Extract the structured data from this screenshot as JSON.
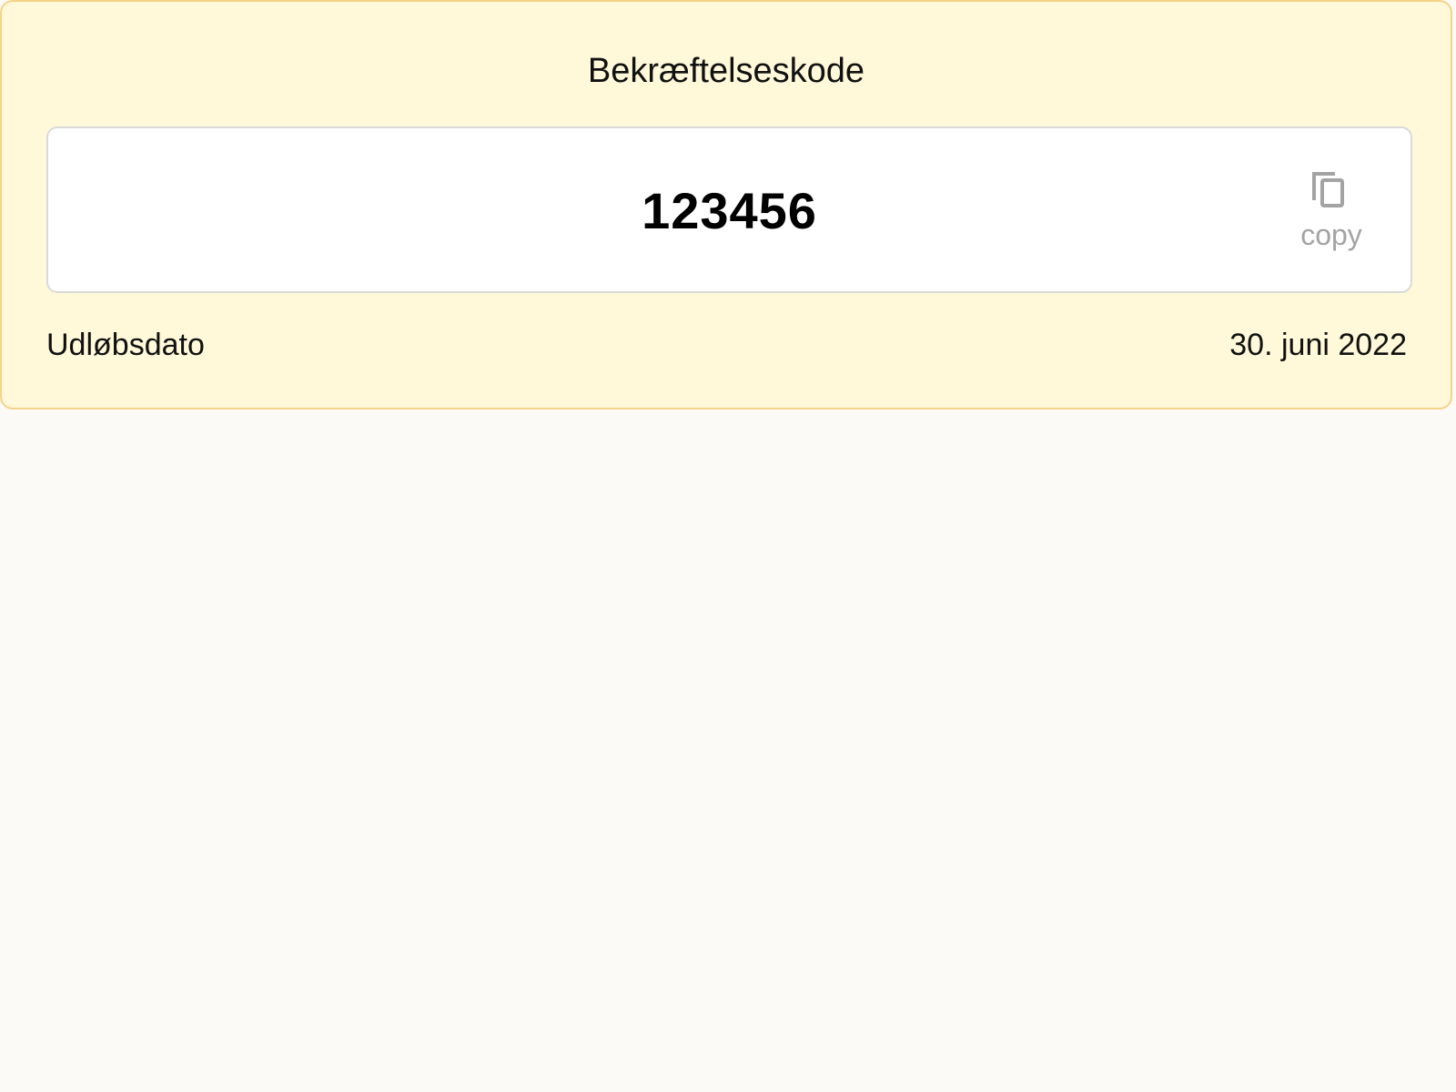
{
  "card": {
    "title": "Bekræftelseskode",
    "code": "123456",
    "copy": {
      "icon": "copy-icon",
      "label": "copy"
    },
    "expiry": {
      "label": "Udløbsdato",
      "value": "30. juni 2022"
    }
  },
  "colors": {
    "page_background": "#fbfaf7",
    "card_background": "#fff8d9",
    "card_border": "#f6d38a",
    "code_box_background": "#ffffff",
    "code_box_border": "#d9d9d9",
    "copy_color": "#a3a3a3"
  }
}
